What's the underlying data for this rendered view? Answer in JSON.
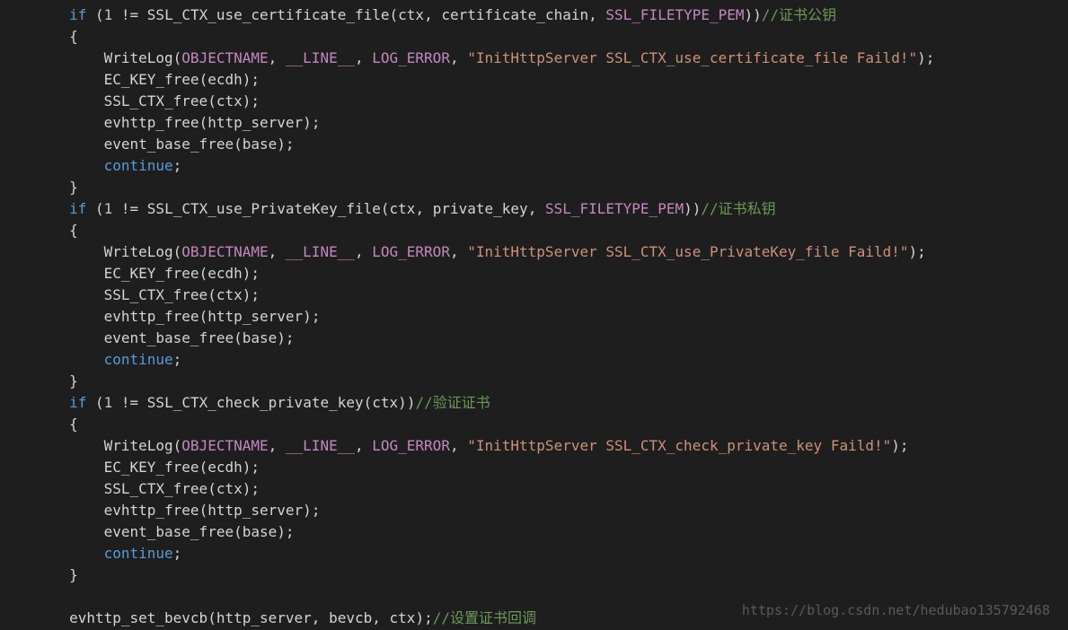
{
  "code": {
    "if": "if",
    "continue": "continue",
    "one": "1",
    "neq": "!=",
    "lparen": "(",
    "rparen": ")",
    "lbrace": "{",
    "rbrace": "}",
    "comma": ",",
    "semi": ";",
    "fn_use_cert": "SSL_CTX_use_certificate_file",
    "fn_use_priv": "SSL_CTX_use_PrivateKey_file",
    "fn_check_priv": "SSL_CTX_check_private_key",
    "fn_writelog": "WriteLog",
    "fn_eckeyfree": "EC_KEY_free",
    "fn_sslctxfree": "SSL_CTX_free",
    "fn_evhttpfree": "evhttp_free",
    "fn_eventbasefree": "event_base_free",
    "fn_setbevcb": "evhttp_set_bevcb",
    "var_ctx": "ctx",
    "var_certchain": "certificate_chain",
    "var_privkey": "private_key",
    "var_ecdh": "ecdh",
    "var_httpserver": "http_server",
    "var_base": "base",
    "var_bevcb": "bevcb",
    "macro_filetype": "SSL_FILETYPE_PEM",
    "macro_objectname": "OBJECTNAME",
    "macro_line": "__LINE__",
    "macro_logerror": "LOG_ERROR",
    "str_cert_fail": "\"InitHttpServer SSL_CTX_use_certificate_file Faild!\"",
    "str_priv_fail": "\"InitHttpServer SSL_CTX_use_PrivateKey_file Faild!\"",
    "str_check_fail": "\"InitHttpServer SSL_CTX_check_private_key Faild!\"",
    "cmt_pubkey": "//证书公钥",
    "cmt_privkey": "//证书私钥",
    "cmt_verify": "//验证证书",
    "cmt_setcb": "//设置证书回调"
  },
  "watermark": "https://blog.csdn.net/hedubao135792468"
}
